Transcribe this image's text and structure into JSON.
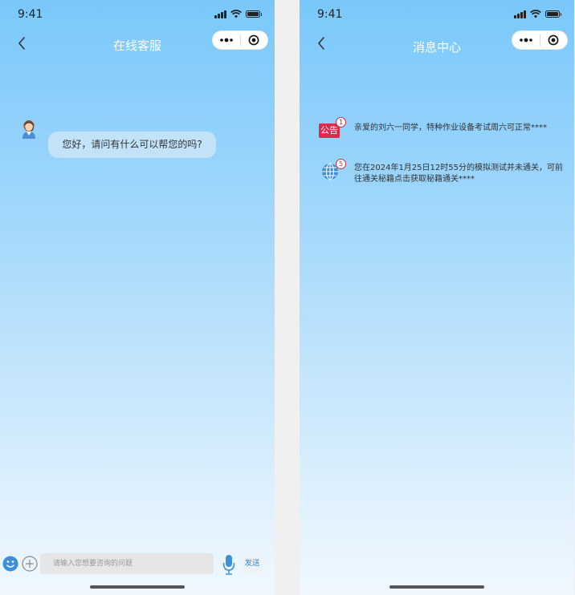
{
  "status_time": "9:41",
  "chat": {
    "title": "在线客服",
    "greeting": "您好，请问有什么可以帮您的吗?",
    "input_placeholder": "请输入您想要咨询的问题",
    "send_label": "发送"
  },
  "messages": {
    "title": "消息中心",
    "items": [
      {
        "icon": "notice-icon",
        "icon_label": "公告",
        "badge": "1",
        "text": "亲爱的刘六一同学，特种作业设备考试周六可正常****"
      },
      {
        "icon": "globe-icon",
        "badge": "5",
        "text": "您在2024年1月25日12时55分的模拟测试并未通关，可前往通关秘籍点击获取秘籍通关****"
      }
    ]
  },
  "colors": {
    "header_gradient_top": "#79c8fb",
    "accent": "#3a86c8",
    "badge": "#d2283c"
  }
}
